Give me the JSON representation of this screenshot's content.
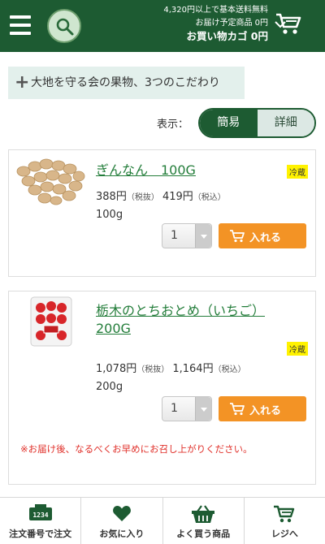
{
  "header": {
    "free_shipping_line": "4,320円以上で基本送料無料",
    "scheduled_line": "お届け予定商品 0円",
    "cart_total_line": "お買い物カゴ 0円"
  },
  "kodawari": {
    "label": "大地を守る会の果物、3つのこだわり"
  },
  "display": {
    "label": "表示：",
    "simple": "簡易",
    "detail": "詳細",
    "selected": "簡易"
  },
  "products": [
    {
      "name": "ぎんなん　100G",
      "badge": "冷蔵",
      "price_ex": "388円",
      "tax_ex_label": "（税抜）",
      "price_in": "419円",
      "tax_in_label": "（税込）",
      "unit": "100g",
      "qty": "1",
      "add_label": "入れる"
    },
    {
      "name_line1": "栃木のとちおとめ（いちご）",
      "name_line2": "200G",
      "badge": "冷蔵",
      "price_ex": "1,078円",
      "tax_ex_label": "（税抜）",
      "price_in": "1,164円",
      "tax_in_label": "（税込）",
      "unit": "200g",
      "qty": "1",
      "add_label": "入れる",
      "notice": "※お届け後、なるべくお早めにお召し上がりください。"
    }
  ],
  "bottom_nav": [
    {
      "label": "注文番号で注文",
      "icon": "order-number-icon",
      "icon_text": "1234"
    },
    {
      "label": "お気に入り",
      "icon": "heart-icon"
    },
    {
      "label": "よく買う商品",
      "icon": "basket-icon"
    },
    {
      "label": "レジへ",
      "icon": "cart-icon"
    }
  ],
  "colors": {
    "brand_green": "#1d5b32",
    "link_green": "#237d3a",
    "orange": "#f39325",
    "badge_yellow": "#fff200",
    "notice_red": "#e0302a"
  }
}
